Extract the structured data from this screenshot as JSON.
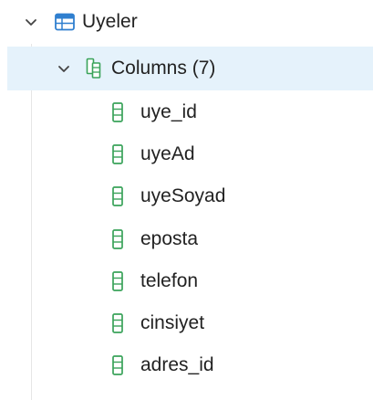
{
  "tree": {
    "table": {
      "label": "Uyeler",
      "icon": "table-icon",
      "expanded": true
    },
    "columns_folder": {
      "label": "Columns (7)",
      "icon": "columns-icon",
      "expanded": true,
      "selected": true
    },
    "columns": [
      {
        "label": "uye_id",
        "icon": "column-icon"
      },
      {
        "label": "uyeAd",
        "icon": "column-icon"
      },
      {
        "label": "uyeSoyad",
        "icon": "column-icon"
      },
      {
        "label": "eposta",
        "icon": "column-icon"
      },
      {
        "label": "telefon",
        "icon": "column-icon"
      },
      {
        "label": "cinsiyet",
        "icon": "column-icon"
      },
      {
        "label": "adres_id",
        "icon": "column-icon"
      }
    ]
  },
  "colors": {
    "selected_bg": "#e5f2fb",
    "table_icon": "#2f7fcf",
    "column_icon": "#3aa35a",
    "text": "#222222"
  }
}
